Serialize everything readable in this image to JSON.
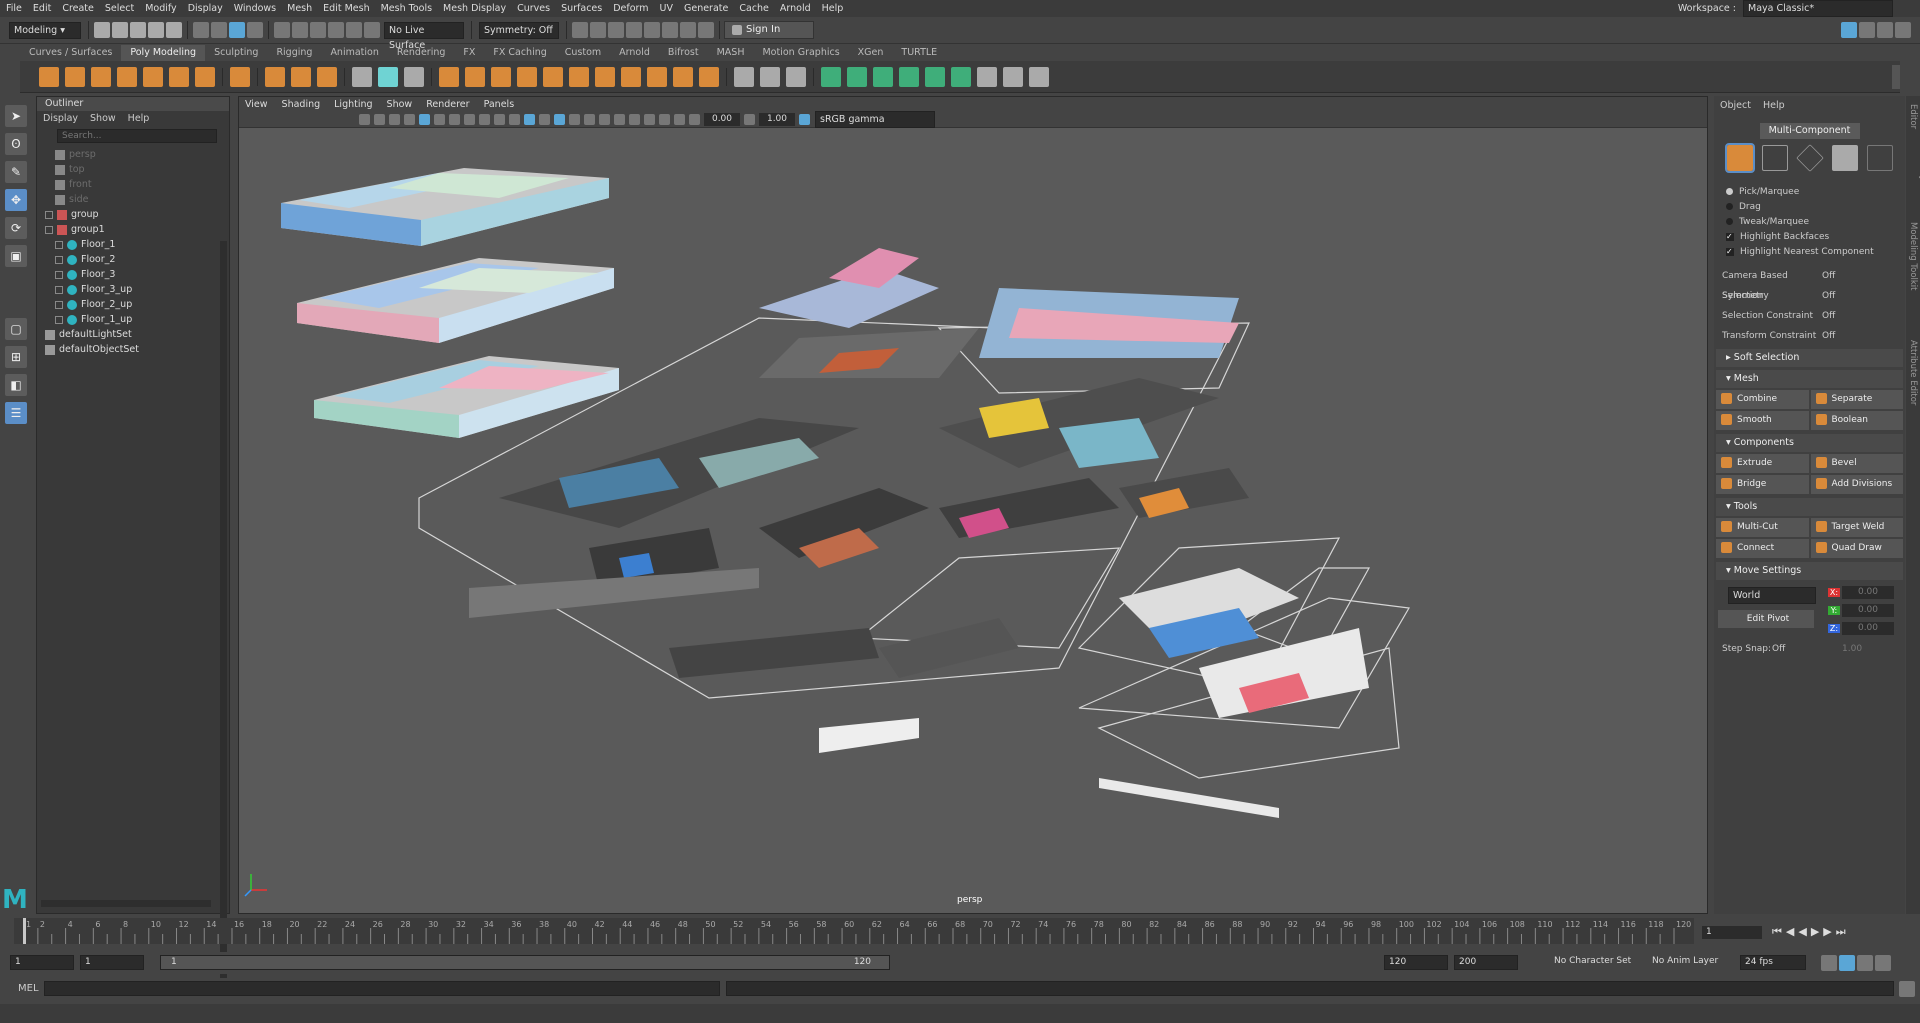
{
  "menus": [
    "File",
    "Edit",
    "Create",
    "Select",
    "Modify",
    "Display",
    "Windows",
    "Mesh",
    "Edit Mesh",
    "Mesh Tools",
    "Mesh Display",
    "Curves",
    "Surfaces",
    "Deform",
    "UV",
    "Generate",
    "Cache",
    "Arnold",
    "Help"
  ],
  "workspace": {
    "label": "Workspace :",
    "value": "Maya Classic*"
  },
  "status": {
    "mode": "Modeling",
    "live_surface": "No Live Surface",
    "symmetry": "Symmetry: Off",
    "signin": "Sign In"
  },
  "shelf_tabs": [
    "Curves / Surfaces",
    "Poly Modeling",
    "Sculpting",
    "Rigging",
    "Animation",
    "Rendering",
    "FX",
    "FX Caching",
    "Custom",
    "Arnold",
    "Bifrost",
    "MASH",
    "Motion Graphics",
    "XGen",
    "TURTLE"
  ],
  "shelf_active": "Poly Modeling",
  "outliner": {
    "title": "Outliner",
    "menu": [
      "Display",
      "Show",
      "Help"
    ],
    "search_placeholder": "Search...",
    "items": [
      {
        "label": "persp",
        "dim": true,
        "indent": 1,
        "type": "camera"
      },
      {
        "label": "top",
        "dim": true,
        "indent": 1,
        "type": "camera"
      },
      {
        "label": "front",
        "dim": true,
        "indent": 1,
        "type": "camera"
      },
      {
        "label": "side",
        "dim": true,
        "indent": 1,
        "type": "camera"
      },
      {
        "label": "group",
        "dim": false,
        "indent": 0,
        "type": "group"
      },
      {
        "label": "group1",
        "dim": false,
        "indent": 0,
        "type": "group"
      },
      {
        "label": "Floor_1",
        "dim": false,
        "indent": 1,
        "type": "joint"
      },
      {
        "label": "Floor_2",
        "dim": false,
        "indent": 1,
        "type": "joint"
      },
      {
        "label": "Floor_3",
        "dim": false,
        "indent": 1,
        "type": "joint"
      },
      {
        "label": "Floor_3_up",
        "dim": false,
        "indent": 1,
        "type": "joint"
      },
      {
        "label": "Floor_2_up",
        "dim": false,
        "indent": 1,
        "type": "joint"
      },
      {
        "label": "Floor_1_up",
        "dim": false,
        "indent": 1,
        "type": "joint"
      },
      {
        "label": "defaultLightSet",
        "dim": false,
        "indent": 0,
        "type": "set"
      },
      {
        "label": "defaultObjectSet",
        "dim": false,
        "indent": 0,
        "type": "set"
      }
    ]
  },
  "viewport": {
    "menu": [
      "View",
      "Shading",
      "Lighting",
      "Show",
      "Renderer",
      "Panels"
    ],
    "exposure": "0.00",
    "gamma": "1.00",
    "colorspace": "sRGB gamma",
    "camera": "persp"
  },
  "modeling_toolkit": {
    "menu": [
      "Object",
      "Help"
    ],
    "mode": "Multi-Component",
    "pick_options": [
      {
        "label": "Pick/Marquee",
        "on": true
      },
      {
        "label": "Drag",
        "on": false
      },
      {
        "label": "Tweak/Marquee",
        "on": false
      }
    ],
    "checks": [
      "Highlight Backfaces",
      "Highlight Nearest Component"
    ],
    "settings": [
      {
        "k": "Camera Based Selection",
        "v": "Off"
      },
      {
        "k": "Symmetry",
        "v": "Off"
      },
      {
        "k": "Selection Constraint",
        "v": "Off"
      },
      {
        "k": "Transform Constraint",
        "v": "Off"
      }
    ],
    "soft_selection": "Soft Selection",
    "sections": [
      {
        "title": "Mesh",
        "buttons": [
          "Combine",
          "Separate",
          "Smooth",
          "Boolean"
        ]
      },
      {
        "title": "Components",
        "buttons": [
          "Extrude",
          "Bevel",
          "Bridge",
          "Add Divisions"
        ]
      },
      {
        "title": "Tools",
        "buttons": [
          "Multi-Cut",
          "Target Weld",
          "Connect",
          "Quad Draw"
        ]
      }
    ],
    "move_settings": {
      "title": "Move Settings",
      "space": "World",
      "edit_pivot": "Edit Pivot",
      "x": "0.00",
      "y": "0.00",
      "z": "0.00"
    },
    "step_snap": {
      "label": "Step Snap:",
      "value": "Off",
      "num": "1.00"
    },
    "side_tabs": [
      "Channel Box / Layer Editor",
      "Modeling Toolkit",
      "Attribute Editor"
    ]
  },
  "timeline": {
    "ticks": [
      "1",
      "2",
      "4",
      "6",
      "8",
      "10",
      "12",
      "14",
      "16",
      "18",
      "20",
      "22",
      "24",
      "26",
      "28",
      "30",
      "32",
      "34",
      "36",
      "38",
      "40",
      "42",
      "44",
      "46",
      "48",
      "50",
      "52",
      "54",
      "56",
      "58",
      "60",
      "62",
      "64",
      "66",
      "68",
      "70",
      "72",
      "74",
      "76",
      "78",
      "80",
      "82",
      "84",
      "86",
      "88",
      "90",
      "92",
      "94",
      "96",
      "98",
      "100",
      "102",
      "104",
      "106",
      "108",
      "110",
      "112",
      "114",
      "116",
      "118",
      "120"
    ],
    "current": "1"
  },
  "range": {
    "start": "1",
    "playback_start": "1",
    "slider_start": "1",
    "slider_end": "120",
    "playback_end": "120",
    "end": "200",
    "character_set": "No Character Set",
    "anim_layer": "No Anim Layer",
    "fps": "24 fps"
  },
  "command": {
    "lang": "MEL"
  },
  "colors": {
    "accent": "#d98a3a",
    "select": "#5b8ec7",
    "maya_logo": "#2fb3c0"
  }
}
